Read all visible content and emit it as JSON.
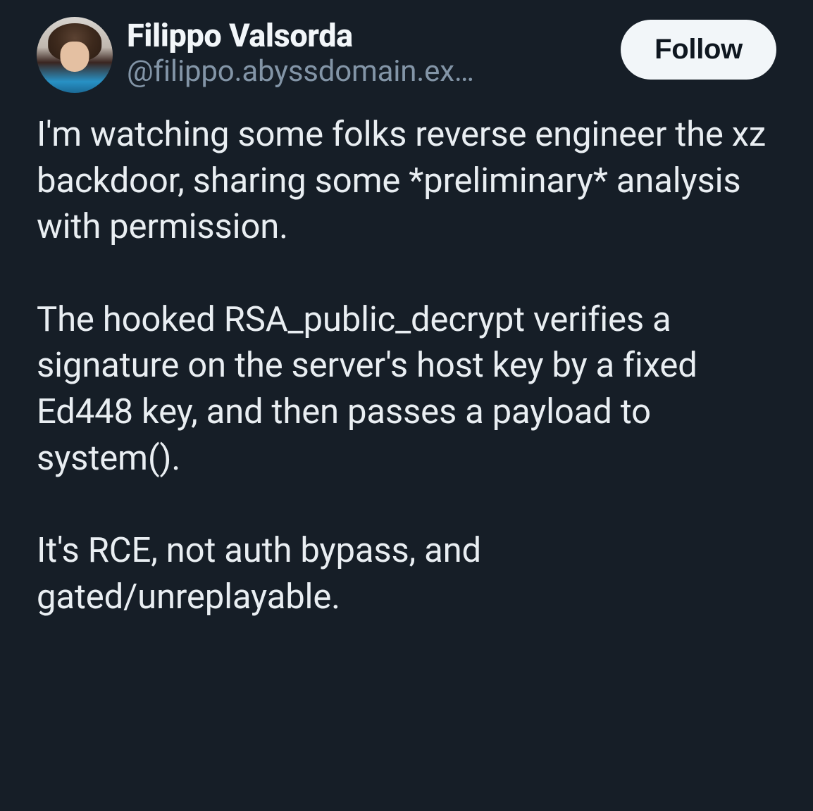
{
  "post": {
    "author": {
      "display_name": "Filippo Valsorda",
      "handle": "@filippo.abyssdomain.ex…"
    },
    "follow_button_label": "Follow",
    "body": "I'm watching some folks reverse engineer the xz backdoor, sharing some *preliminary* analysis with permission.\n\nThe hooked RSA_public_decrypt verifies a signature on the server's host key by a fixed Ed448 key, and then passes a payload to system().\n\nIt's RCE, not auth bypass, and gated/unreplayable."
  }
}
